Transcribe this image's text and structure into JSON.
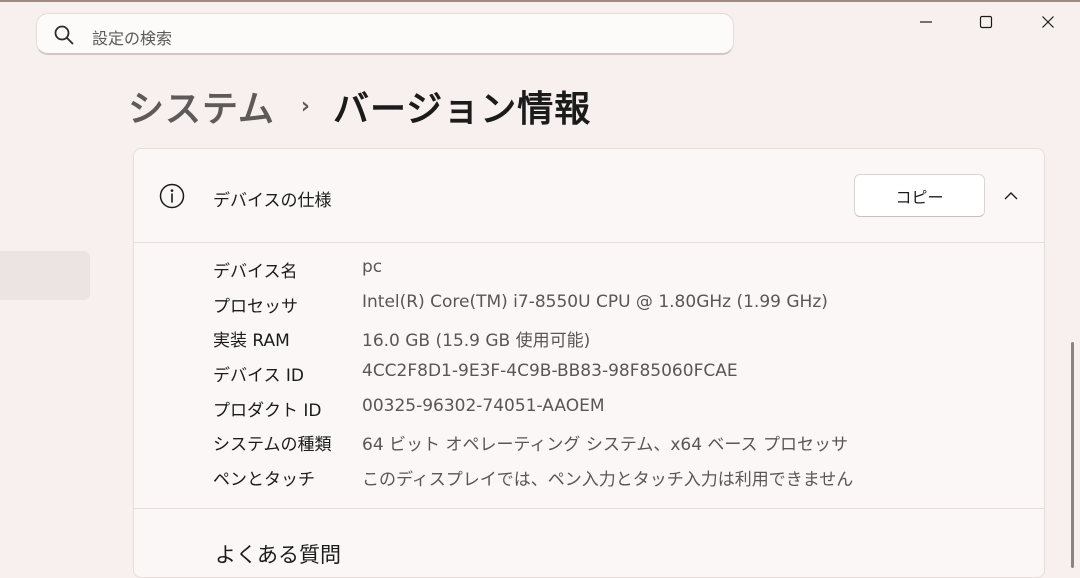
{
  "search": {
    "placeholder": "設定の検索",
    "icon": "search-icon"
  },
  "window_controls": {
    "minimize": "minimize-icon",
    "maximize": "maximize-icon",
    "close": "close-icon"
  },
  "breadcrumb": {
    "parent": "システム",
    "separator": "›",
    "current": "バージョン情報"
  },
  "device_specs": {
    "heading": "デバイスの仕様",
    "copy_label": "コピー",
    "collapse_icon": "chevron-up-icon",
    "rows": [
      {
        "label": "デバイス名",
        "value": "pc"
      },
      {
        "label": "プロセッサ",
        "value": "Intel(R) Core(TM) i7-8550U CPU @ 1.80GHz (1.99 GHz)"
      },
      {
        "label": "実装 RAM",
        "value": "16.0 GB (15.9 GB 使用可能)"
      },
      {
        "label": "デバイス ID",
        "value": "4CC2F8D1-9E3F-4C9B-BB83-98F85060FCAE"
      },
      {
        "label": "プロダクト ID",
        "value": "00325-96302-74051-AAOEM"
      },
      {
        "label": "システムの種類",
        "value": "64 ビット オペレーティング システム、x64 ベース プロセッサ"
      },
      {
        "label": "ペンとタッチ",
        "value": "このディスプレイでは、ペン入力とタッチ入力は利用できません"
      }
    ]
  },
  "faq": {
    "heading": "よくある質問"
  },
  "colors": {
    "background": "#f8f0ef",
    "card": "#fbf7f7",
    "text": "#1b1b1b",
    "muted": "#5a5656"
  }
}
